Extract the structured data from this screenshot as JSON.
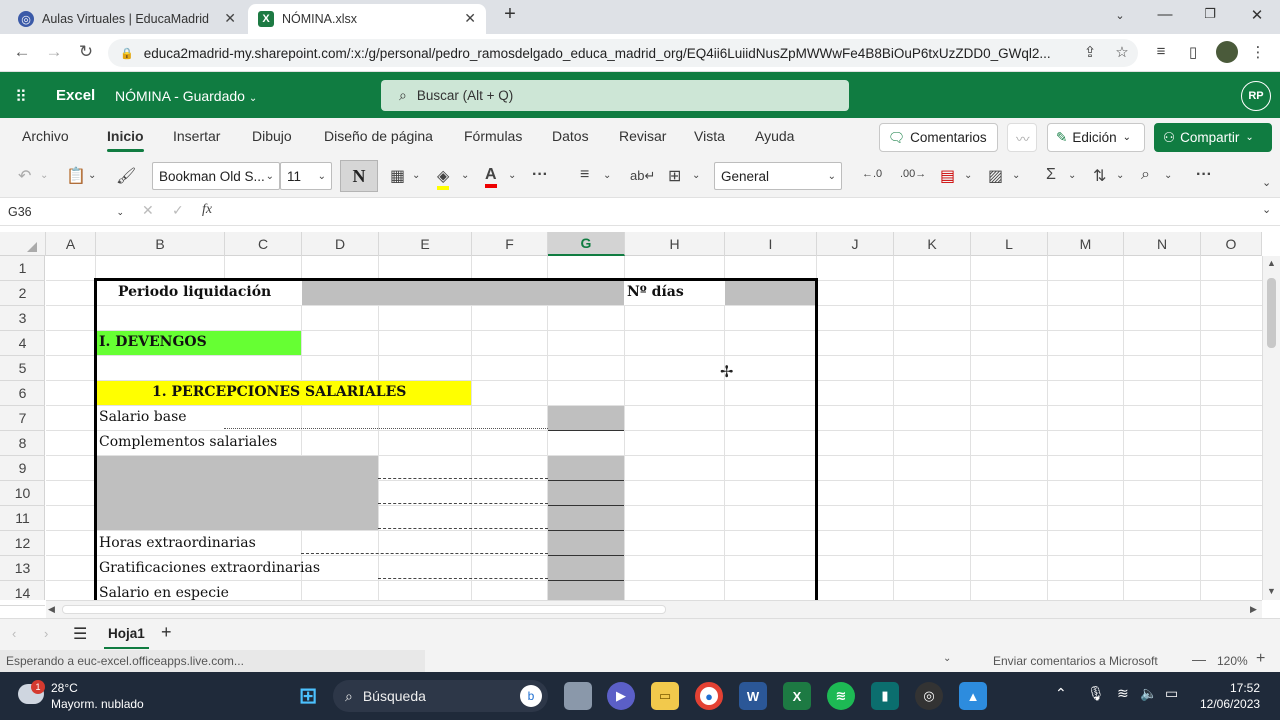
{
  "browser": {
    "tabs": [
      {
        "label": "Aulas Virtuales | EducaMadrid",
        "icon": "educamadrid-icon"
      },
      {
        "label": "NÓMINA.xlsx",
        "icon": "excel-icon"
      }
    ],
    "url": "educa2madrid-my.sharepoint.com/:x:/g/personal/pedro_ramosdelgado_educa_madrid_org/EQ4ii6LuiidNusZpMWWwFe4B8BiOuP6txUzZDD0_GWql2..."
  },
  "excel": {
    "app_name": "Excel",
    "doc_title": "NÓMINA",
    "doc_status": "Guardado",
    "search_placeholder": "Buscar (Alt + Q)",
    "user_initials": "RP",
    "ribbon_tabs": [
      "Archivo",
      "Inicio",
      "Insertar",
      "Dibujo",
      "Diseño de página",
      "Fórmulas",
      "Datos",
      "Revisar",
      "Vista",
      "Ayuda"
    ],
    "active_tab": "Inicio",
    "comments_label": "Comentarios",
    "edit_label": "Edición",
    "share_label": "Compartir",
    "font_name": "Bookman Old S...",
    "font_size": "11",
    "bold_label": "N",
    "number_format": "General",
    "name_box": "G36",
    "fx_label": "fx",
    "columns": [
      "A",
      "B",
      "C",
      "D",
      "E",
      "F",
      "G",
      "H",
      "I",
      "J",
      "K",
      "L",
      "M",
      "N",
      "O"
    ],
    "selected_column": "G",
    "rows": [
      "1",
      "2",
      "3",
      "4",
      "5",
      "6",
      "7",
      "8",
      "9",
      "10",
      "11",
      "12",
      "13",
      "14"
    ],
    "cells": {
      "b2": "Periodo liquidación",
      "h2": "Nº días",
      "b4": "I. DEVENGOS",
      "b6": "1. PERCEPCIONES SALARIALES",
      "b7": "Salario base",
      "b8": "Complementos salariales",
      "b12": "Horas extraordinarias",
      "b13": "Gratificaciones extraordinarias",
      "b14": "Salario en especie"
    },
    "colors": {
      "brand": "#107c41",
      "devengos_fill": "#66ff33",
      "percepciones_fill": "#ffff00",
      "input_fill": "#bfbfbf"
    },
    "sheet_tab": "Hoja1",
    "status_text": "Esperando a euc-excel.officeapps.live.com...",
    "feedback_text": "Enviar comentarios a Microsoft",
    "zoom": "120%"
  },
  "taskbar": {
    "weather_temp": "28°C",
    "weather_desc": "Mayorm. nublado",
    "weather_badge": "1",
    "search_label": "Búsqueda",
    "time": "17:52",
    "date": "12/06/2023"
  }
}
